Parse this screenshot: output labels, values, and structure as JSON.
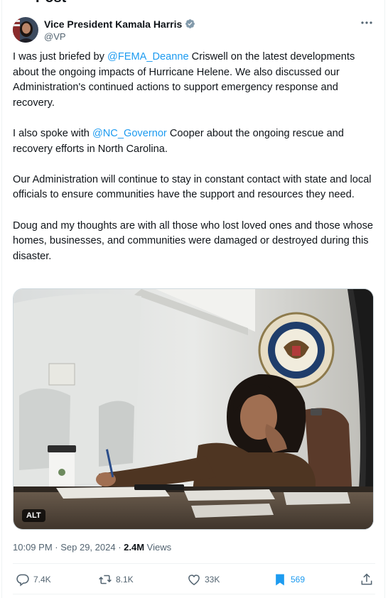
{
  "header": {
    "title": "Post"
  },
  "author": {
    "name": "Vice President Kamala Harris",
    "handle": "@VP",
    "verified_color": "#829aab"
  },
  "tweet": {
    "p1_a": "I was just briefed by ",
    "p1_mention": "@FEMA_Deanne",
    "p1_b": " Criswell on the latest developments about the ongoing impacts of Hurricane Helene. We also discussed our Administration's continued actions to support emergency response and recovery.",
    "p2_a": "I also spoke with ",
    "p2_mention": "@NC_Governor",
    "p2_b": " Cooper about the ongoing rescue and recovery efforts in North Carolina.",
    "p3": "Our Administration will continue to stay in constant contact with state and local officials to ensure communities have the support and resources they need.",
    "p4": "Doug and my thoughts are with all those who lost loved ones and those whose homes, businesses, and communities were damaged or destroyed during this disaster."
  },
  "media": {
    "alt_label": "ALT",
    "seal_text": "VICE PRESIDENT OF THE UNITED STATES"
  },
  "meta": {
    "time": "10:09 PM",
    "sep1": " · ",
    "date": "Sep 29, 2024",
    "sep2": " · ",
    "views_count": "2.4M",
    "views_label": " Views"
  },
  "actions": {
    "replies": "7.4K",
    "reposts": "8.1K",
    "likes": "33K",
    "bookmarks": "569"
  },
  "colors": {
    "link": "#1d9bf0",
    "muted": "#536471",
    "text": "#0f1419"
  }
}
